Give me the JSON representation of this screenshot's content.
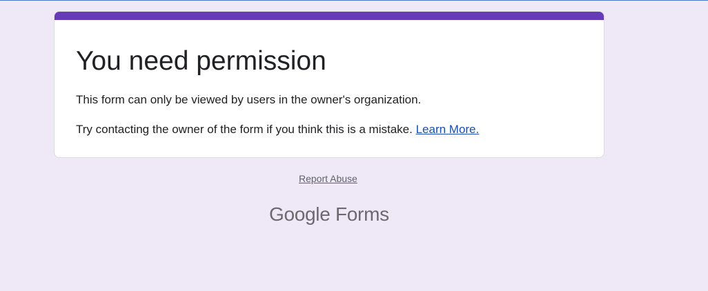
{
  "card": {
    "title": "You need permission",
    "message_line1": "This form can only be viewed by users in the owner's organization.",
    "message_line2_prefix": "Try contacting the owner of the form if you think this is a mistake. ",
    "learn_more_label": "Learn More."
  },
  "footer": {
    "report_abuse_label": "Report Abuse",
    "logo_text": "Google Forms"
  },
  "colors": {
    "page_background": "#efe9f7",
    "accent": "#673ab7",
    "link": "#1a4fae"
  }
}
